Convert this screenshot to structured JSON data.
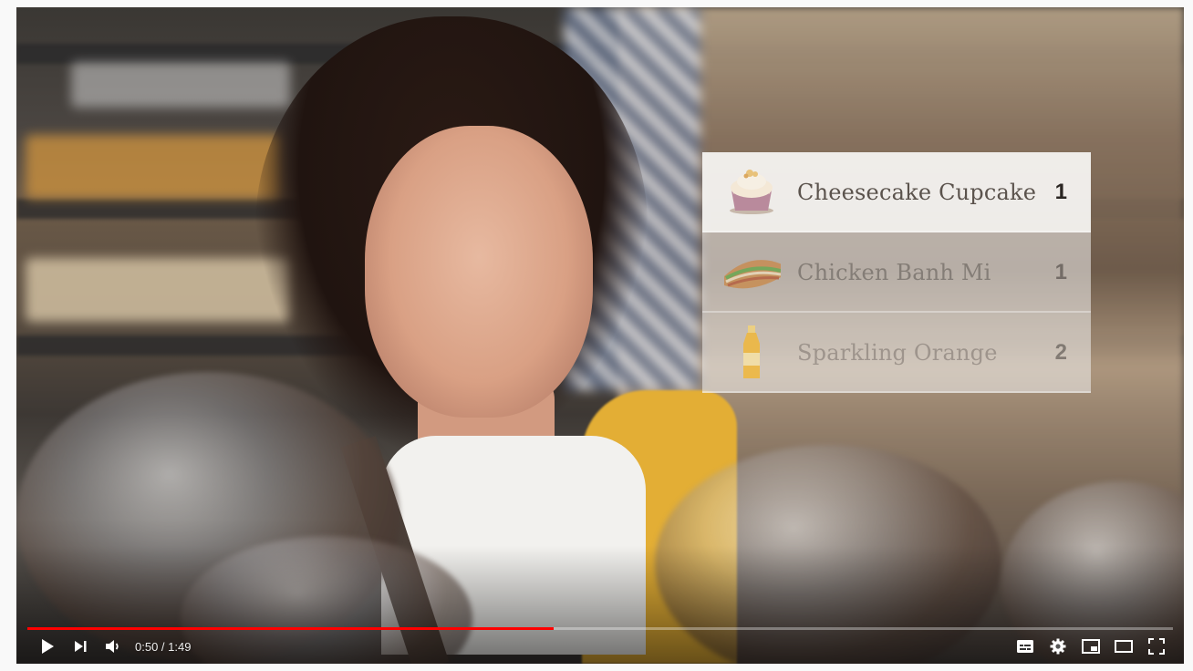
{
  "video": {
    "overlay_items": [
      {
        "name": "Cheesecake Cupcake",
        "qty": "1",
        "icon": "cupcake-icon"
      },
      {
        "name": "Chicken Banh Mi",
        "qty": "1",
        "icon": "sandwich-icon"
      },
      {
        "name": "Sparkling Orange",
        "qty": "2",
        "icon": "bottle-icon"
      }
    ]
  },
  "controls": {
    "current_time": "0:50",
    "duration": "1:49",
    "time_display": "0:50 / 1:49",
    "progress_fraction": 0.459,
    "play_icon": "play-icon",
    "next_icon": "next-icon",
    "volume_icon": "volume-icon",
    "captions_icon": "subtitles-icon",
    "settings_icon": "gear-icon",
    "miniplayer_icon": "miniplayer-icon",
    "theater_icon": "theater-mode-icon",
    "fullscreen_icon": "fullscreen-icon"
  },
  "colors": {
    "progress": "#ff0000",
    "control_icons": "#ffffff"
  }
}
